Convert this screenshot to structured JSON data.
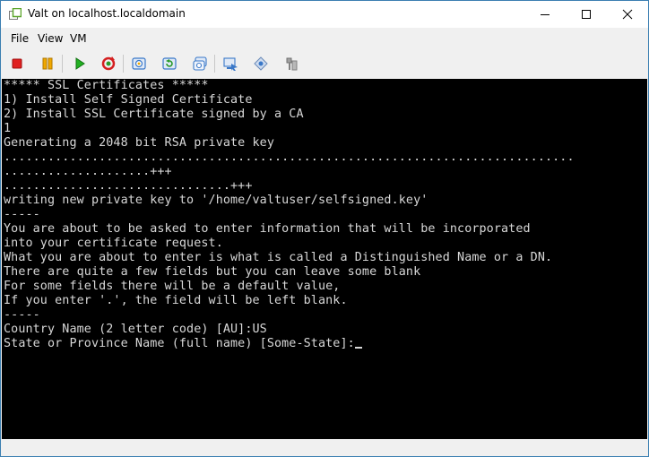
{
  "window": {
    "title": "Valt on localhost.localdomain",
    "app_icon": "vmware-icon",
    "controls": [
      "minimize-icon",
      "maximize-icon",
      "close-icon"
    ]
  },
  "menu": {
    "items": [
      "File",
      "View",
      "VM"
    ]
  },
  "toolbar": {
    "buttons": [
      {
        "name": "stop-button",
        "icon": "stop-icon",
        "color": "#e02020"
      },
      {
        "name": "suspend-button",
        "icon": "pause-icon",
        "color": "#e89a00"
      },
      {
        "name": "power-on-button",
        "icon": "play-icon",
        "color": "#1a9a1a"
      },
      {
        "name": "reset-button",
        "icon": "reset-icon",
        "color": "#d42020"
      },
      {
        "name": "snapshot-button",
        "icon": "snapshot-icon",
        "color": "#3a78c8"
      },
      {
        "name": "revert-snapshot-button",
        "icon": "revert-snapshot-icon",
        "color": "#3a78c8"
      },
      {
        "name": "manage-snapshots-button",
        "icon": "manage-snapshots-icon",
        "color": "#3a78c8"
      },
      {
        "name": "console-button",
        "icon": "console-icon",
        "color": "#3a78c8"
      },
      {
        "name": "vm-settings-button",
        "icon": "settings-icon",
        "color": "#3a78c8"
      },
      {
        "name": "tools-button",
        "icon": "tools-icon",
        "color": "#8a8a8a"
      }
    ]
  },
  "console": {
    "background": "#000000",
    "foreground": "#d8d8d8",
    "lines": [
      "***** SSL Certificates *****",
      "1) Install Self Signed Certificate",
      "2) Install SSL Certificate signed by a CA",
      "1",
      "Generating a 2048 bit RSA private key",
      "..............................................................................",
      "....................+++",
      "...............................+++",
      "writing new private key to '/home/valtuser/selfsigned.key'",
      "-----",
      "You are about to be asked to enter information that will be incorporated",
      "into your certificate request.",
      "What you are about to enter is what is called a Distinguished Name or a DN.",
      "There are quite a few fields but you can leave some blank",
      "For some fields there will be a default value,",
      "If you enter '.', the field will be left blank.",
      "-----",
      "Country Name (2 letter code) [AU]:US",
      "State or Province Name (full name) [Some-State]:"
    ]
  }
}
